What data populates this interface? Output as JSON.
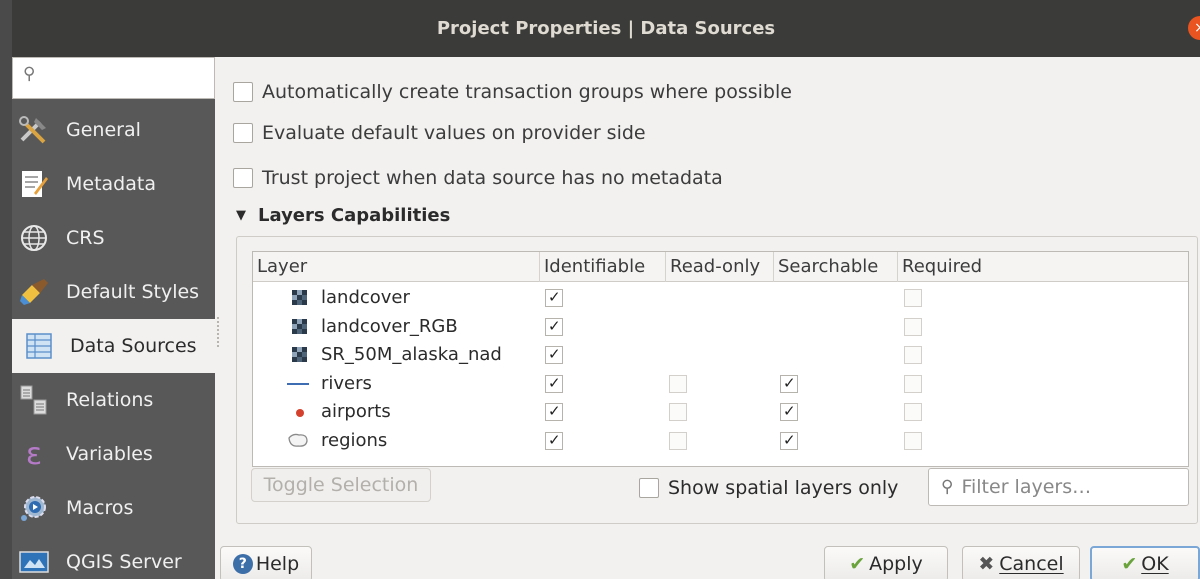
{
  "window": {
    "title": "Project Properties | Data Sources",
    "close_glyph": "×"
  },
  "sidebar": {
    "search_icon": "search-icon",
    "items": [
      {
        "label": "General",
        "icon": "hammer-wrench-icon"
      },
      {
        "label": "Metadata",
        "icon": "document-edit-icon"
      },
      {
        "label": "CRS",
        "icon": "globe-icon"
      },
      {
        "label": "Default Styles",
        "icon": "paintbrush-icon"
      },
      {
        "label": "Data Sources",
        "icon": "table-icon",
        "active": true
      },
      {
        "label": "Relations",
        "icon": "relations-icon"
      },
      {
        "label": "Variables",
        "icon": "epsilon-icon"
      },
      {
        "label": "Macros",
        "icon": "gear-play-icon"
      },
      {
        "label": "QGIS Server",
        "icon": "server-icon"
      }
    ]
  },
  "options": {
    "transaction_groups": "Automatically create transaction groups where possible",
    "default_values": "Evaluate default values on provider side",
    "trust_project": "Trust project when data source has no metadata"
  },
  "layers_section": {
    "title": "Layers Capabilities",
    "toggle_glyph": "▼"
  },
  "table": {
    "headers": [
      "Layer",
      "Identifiable",
      "Read-only",
      "Searchable",
      "Required"
    ],
    "rows": [
      {
        "name": "landcover",
        "type": "raster",
        "identifiable": true,
        "readonly": null,
        "searchable": null,
        "required": false
      },
      {
        "name": "landcover_RGB",
        "type": "raster",
        "identifiable": true,
        "readonly": null,
        "searchable": null,
        "required": false
      },
      {
        "name": "SR_50M_alaska_nad",
        "type": "raster",
        "identifiable": true,
        "readonly": null,
        "searchable": null,
        "required": false
      },
      {
        "name": "rivers",
        "type": "line",
        "identifiable": true,
        "readonly": false,
        "searchable": true,
        "required": false
      },
      {
        "name": "airports",
        "type": "point",
        "identifiable": true,
        "readonly": false,
        "searchable": true,
        "required": false
      },
      {
        "name": "regions",
        "type": "polygon",
        "identifiable": true,
        "readonly": false,
        "searchable": true,
        "required": false
      }
    ]
  },
  "toggle_selection": "Toggle Selection",
  "show_spatial": "Show spatial layers only",
  "filter": {
    "placeholder": "Filter layers…",
    "icon": "search-icon"
  },
  "buttons": {
    "help": "Help",
    "apply": "Apply",
    "cancel": "Cancel",
    "ok": "OK"
  },
  "colors": {
    "titlebar": "#3b3b39",
    "sidebar": "#585858",
    "close": "#e95420",
    "point": "#d4412c",
    "default_border": "#7aa7d6"
  }
}
